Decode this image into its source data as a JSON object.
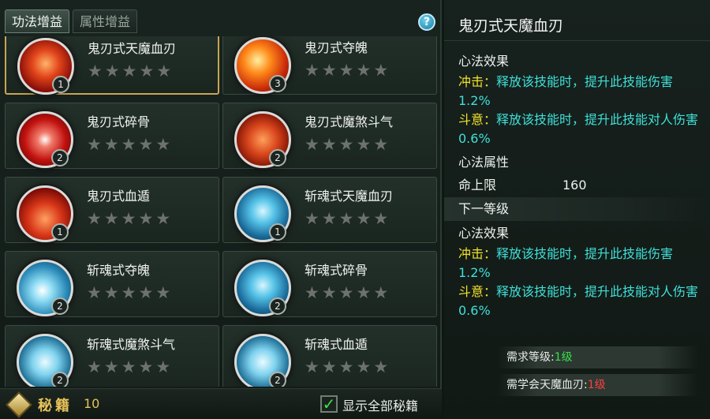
{
  "tabs": [
    {
      "label": "功法增益",
      "active": true
    },
    {
      "label": "属性增益",
      "active": false
    }
  ],
  "help_label": "?",
  "skills": [
    {
      "name": "鬼刃式天魔血刃",
      "level": "1",
      "stars": 5,
      "icon": "red-demon-blade-icon",
      "theme": "t-red",
      "selected": true
    },
    {
      "name": "鬼刃式夺魄",
      "level": "3",
      "stars": 5,
      "icon": "fire-soul-slash-icon",
      "theme": "t-fire",
      "selected": false
    },
    {
      "name": "鬼刃式碎骨",
      "level": "2",
      "stars": 5,
      "icon": "red-bone-shatter-icon",
      "theme": "t-redwhite",
      "selected": false
    },
    {
      "name": "鬼刃式魔煞斗气",
      "level": "2",
      "stars": 5,
      "icon": "red-demon-face-icon",
      "theme": "t-ogre",
      "selected": false
    },
    {
      "name": "鬼刃式血遁",
      "level": "1",
      "stars": 5,
      "icon": "blood-escape-icon",
      "theme": "t-blood",
      "selected": false
    },
    {
      "name": "斩魂式天魔血刃",
      "level": "1",
      "stars": 5,
      "icon": "blue-demon-blade-icon",
      "theme": "t-blue",
      "selected": false
    },
    {
      "name": "斩魂式夺魄",
      "level": "2",
      "stars": 5,
      "icon": "blue-soul-slash-icon",
      "theme": "t-bluewhite",
      "selected": false
    },
    {
      "name": "斩魂式碎骨",
      "level": "2",
      "stars": 5,
      "icon": "blue-bone-shatter-icon",
      "theme": "t-blue",
      "selected": false
    },
    {
      "name": "斩魂式魔煞斗气",
      "level": "2",
      "stars": 5,
      "icon": "blue-demon-face-icon",
      "theme": "t-ice",
      "selected": false
    },
    {
      "name": "斩魂式血遁",
      "level": "2",
      "stars": 5,
      "icon": "blue-escape-icon",
      "theme": "t-ice",
      "selected": false
    }
  ],
  "bottom": {
    "book_label": "秘籍",
    "book_count": "10",
    "show_all_label": "显示全部秘籍",
    "show_all_checked": true
  },
  "detail": {
    "title": "鬼刃式天魔血刃",
    "current": {
      "effect_heading": "心法效果",
      "effects": [
        {
          "key": "冲击：",
          "value": "释放该技能时，提升此技能伤害1.2%"
        },
        {
          "key": "斗意：",
          "value": "释放该技能时，提升此技能对人伤害0.6%"
        }
      ],
      "attr_heading": "心法属性",
      "attrs": [
        {
          "name": "命上限",
          "value": "160"
        }
      ]
    },
    "next_level_label": "下一等级",
    "next": {
      "effect_heading": "心法效果",
      "effects": [
        {
          "key": "冲击：",
          "value": "释放该技能时，提升此技能伤害1.2%"
        },
        {
          "key": "斗意：",
          "value": "释放该技能时，提升此技能对人伤害0.6%"
        }
      ]
    },
    "requirements": [
      {
        "label": "需求等级:",
        "value": "1级",
        "status": "ok"
      },
      {
        "label": "需学会天魔血刃:",
        "value": "1级",
        "status": "bad"
      }
    ]
  }
}
